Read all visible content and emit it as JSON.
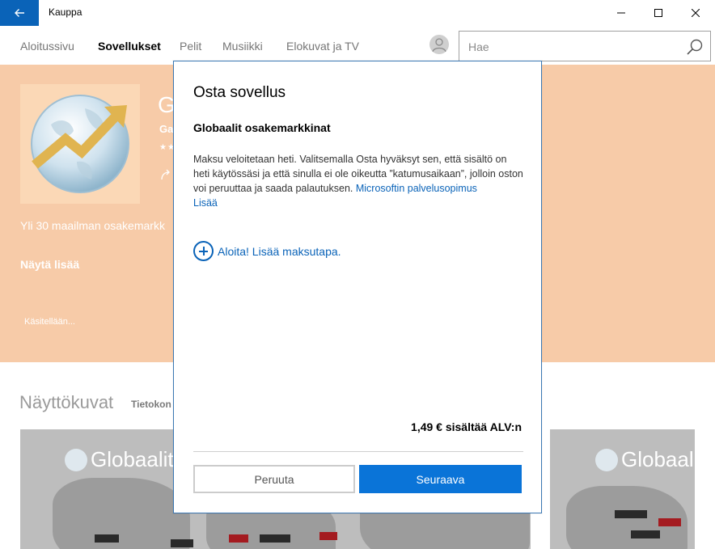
{
  "window": {
    "title": "Kauppa"
  },
  "nav": {
    "items": [
      {
        "label": "Aloitussivu"
      },
      {
        "label": "Sovellukset"
      },
      {
        "label": "Pelit"
      },
      {
        "label": "Musiikki"
      },
      {
        "label": "Elokuvat ja TV"
      }
    ],
    "active": "Sovellukset",
    "search_placeholder": "Hae"
  },
  "hero": {
    "title_fragment": "G",
    "publisher_fragment": "Ga",
    "rating_fragment": "★★",
    "description_fragment": "Yli 30 maailman osakemarkk",
    "show_more": "Näytä lisää",
    "status": "Käsitellään..."
  },
  "screenshots": {
    "heading": "Näyttökuvat",
    "tab_fragment": "Tietokon",
    "logo_text_1": "Globaalit",
    "logo_text_2": "Globaalit"
  },
  "dialog": {
    "title": "Osta sovellus",
    "app_name": "Globaalit osakemarkkinat",
    "body_text": "Maksu veloitetaan heti. Valitsemalla Osta hyväksyt sen, että sisältö on heti käytössäsi ja että sinulla ei ole oikeutta ”katumusaikaan”, jolloin oston voi peruuttaa ja saada palautuksen. ",
    "link_terms": "Microsoftin palvelusopimus",
    "link_more": "Lisää",
    "add_payment": "Aloita! Lisää maksutapa.",
    "price": "1,49 € sisältää ALV:n",
    "cancel_label": "Peruuta",
    "next_label": "Seuraava"
  },
  "colors": {
    "accent": "#0a74d8",
    "back_button": "#0a63b8",
    "hero_background": "#f7cba8"
  }
}
